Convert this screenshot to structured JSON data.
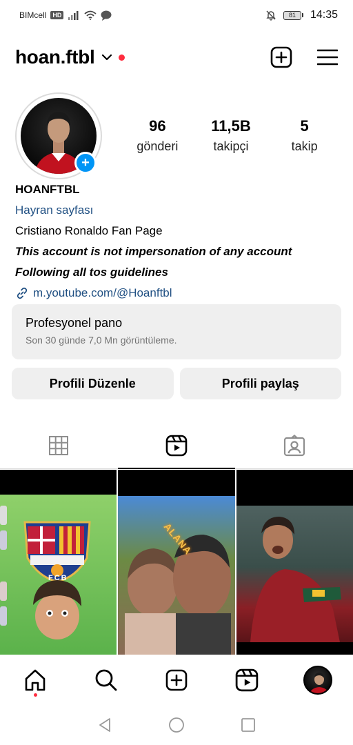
{
  "status_bar": {
    "carrier": "BIMcell",
    "network_badge": "HD",
    "battery_level": "81",
    "time": "14:35"
  },
  "header": {
    "username": "hoan.ftbl"
  },
  "stats": [
    {
      "value": "96",
      "label": "gönderi"
    },
    {
      "value": "11,5B",
      "label": "takipçi"
    },
    {
      "value": "5",
      "label": "takip"
    }
  ],
  "bio": {
    "name": "HOANFTBL",
    "category": "Hayran sayfası",
    "line1": "Cristiano Ronaldo Fan Page",
    "line2": "This account is not impersonation of any account",
    "line3": "Following all tos guidelines",
    "link": "m.youtube.com/@Hoanftbl"
  },
  "dashboard": {
    "title": "Profesyonel pano",
    "subtitle": "Son 30 günde 7,0 Mn görüntüleme."
  },
  "actions": {
    "edit_label": "Profili Düzenle",
    "share_label": "Profili paylaş"
  },
  "tabs": [
    "grid-icon",
    "reels-icon",
    "tagged-icon"
  ],
  "active_tab": "reels",
  "grid_posts": [
    {
      "caption": "FCB"
    },
    {
      "caption": "ALANA"
    },
    {
      "caption": ""
    }
  ],
  "bottom_nav": [
    "home-icon",
    "search-icon",
    "create-icon",
    "reels-icon",
    "profile-avatar"
  ],
  "colors": {
    "accent_blue": "#0095f6",
    "link_blue": "#1f4f82",
    "notification_red": "#ff2d3f",
    "button_bg": "#efefef"
  }
}
